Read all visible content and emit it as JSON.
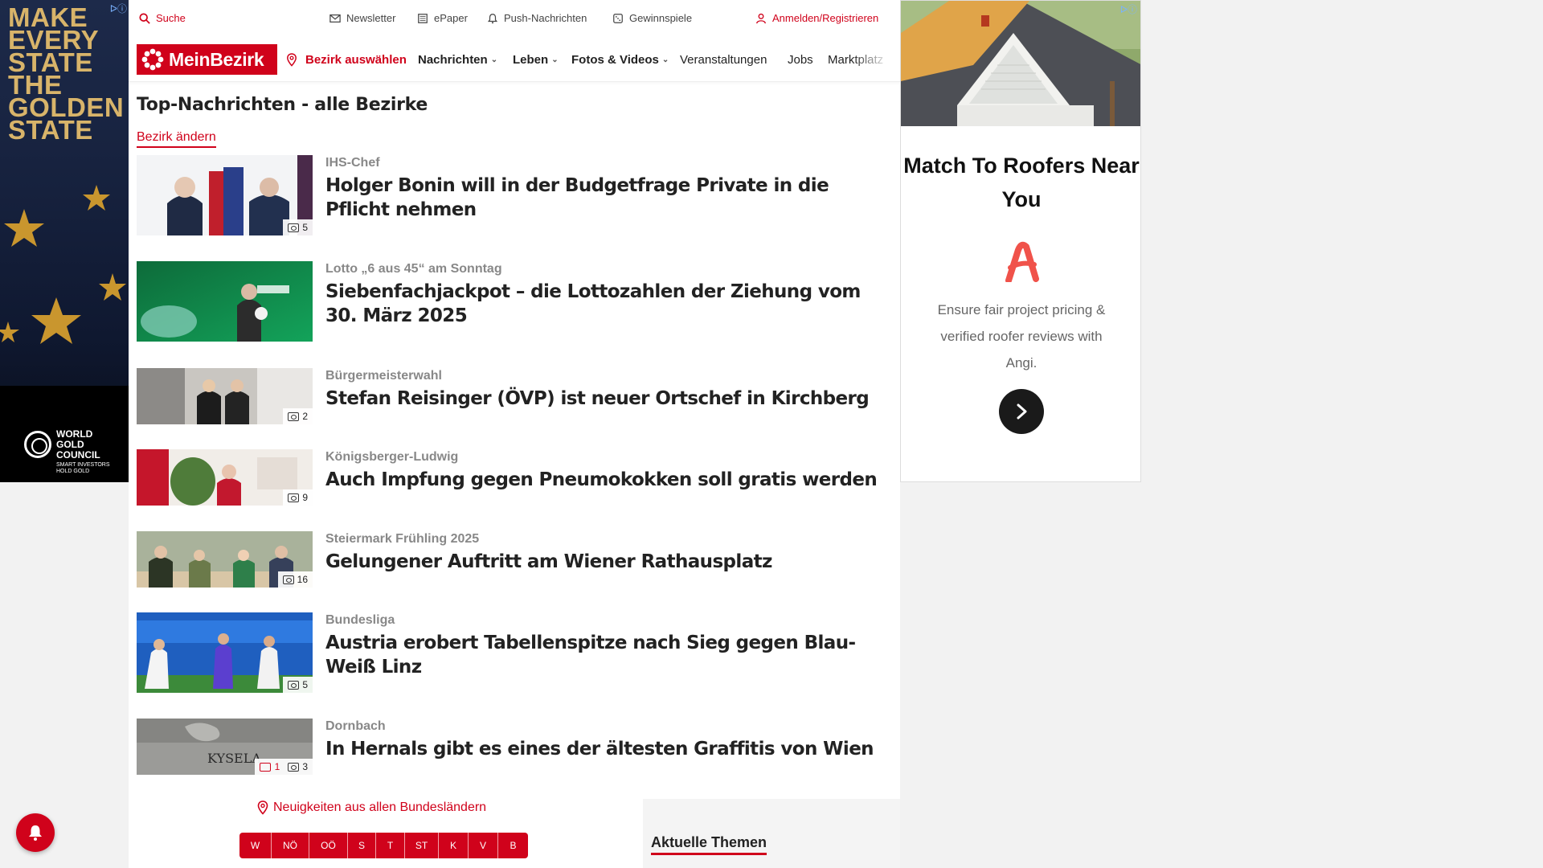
{
  "ad_left": {
    "headline": "MAKE\nEVERY\nSTATE\nTHE\nGOLDEN\nSTATE",
    "brand_name": "WORLD\nGOLD\nCOUNCIL",
    "brand_tagline": "SMART INVESTORS\nHOLD GOLD",
    "badge": "ᐅⓘ"
  },
  "utility": {
    "search": "Suche",
    "newsletter": "Newsletter",
    "epaper": "ePaper",
    "push": "Push-Nachrichten",
    "gewinnspiele": "Gewinnspiele",
    "login": "Anmelden/Registrieren"
  },
  "nav": {
    "logo": "MeinBezirk",
    "bezirk": "Bezirk auswählen",
    "items": [
      "Nachrichten",
      "Leben",
      "Fotos & Videos",
      "Veranstaltungen",
      "Jobs",
      "Marktplatz"
    ]
  },
  "section": {
    "title": "Top-Nachrichten - alle Bezirke",
    "change_link": "Bezirk ändern"
  },
  "articles": [
    {
      "kicker": "IHS-Chef",
      "title": "Holger Bonin will in der Budgetfrage Private in die Pflicht nehmen",
      "photos": "5",
      "comments": ""
    },
    {
      "kicker": "Lotto „6 aus 45“ am Sonntag",
      "title": "Siebenfachjackpot – die Lottozahlen der Ziehung vom 30. März 2025",
      "photos": "",
      "comments": ""
    },
    {
      "kicker": "Bürgermeisterwahl",
      "title": "Stefan Reisinger (ÖVP) ist neuer Ortschef in Kirchberg",
      "photos": "2",
      "comments": ""
    },
    {
      "kicker": "Königsberger-Ludwig",
      "title": "Auch Impfung gegen Pneumokokken soll gratis werden",
      "photos": "9",
      "comments": ""
    },
    {
      "kicker": "Steiermark Frühling 2025",
      "title": "Gelungener Auftritt am Wiener Rathausplatz",
      "photos": "16",
      "comments": ""
    },
    {
      "kicker": "Bundesliga",
      "title": "Austria erobert Tabellenspitze nach Sieg gegen Blau-Weiß Linz",
      "photos": "5",
      "comments": ""
    },
    {
      "kicker": "Dornbach",
      "title": "In Hernals gibt es eines der ältesten Graffitis von Wien",
      "photos": "3",
      "comments": "1"
    }
  ],
  "footer_nav": {
    "bundes_link": "Neuigkeiten aus allen Bundesländern",
    "states": [
      "W",
      "NÖ",
      "OÖ",
      "S",
      "T",
      "ST",
      "K",
      "V",
      "B"
    ],
    "aktuelle_themen": "Aktuelle Themen"
  },
  "ad_right": {
    "headline": "Match To Roofers Near You",
    "body": "Ensure fair project pricing & verified roofer reviews with Angi.",
    "badge": "ᐅⓘ"
  },
  "colors": {
    "brand_red": "#d0021b",
    "text_dark": "#222222",
    "kicker_gray": "#888888"
  }
}
